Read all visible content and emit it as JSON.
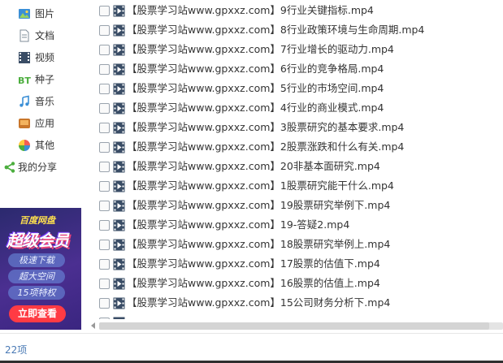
{
  "sidebar": {
    "items": [
      {
        "label": "图片",
        "icon": "picture-icon"
      },
      {
        "label": "文档",
        "icon": "document-icon"
      },
      {
        "label": "视频",
        "icon": "video-icon"
      },
      {
        "label": "种子",
        "icon": "bt-icon"
      },
      {
        "label": "音乐",
        "icon": "music-icon"
      },
      {
        "label": "应用",
        "icon": "app-icon"
      },
      {
        "label": "其他",
        "icon": "other-icon"
      }
    ],
    "share": {
      "label": "我的分享",
      "icon": "share-icon"
    }
  },
  "promo": {
    "brand": "百度网盘",
    "headline": "超级会员",
    "benefits": [
      "极速下载",
      "超大空间",
      "15项特权"
    ],
    "cta": "立即查看"
  },
  "files": [
    "【股票学习站www.gpxxz.com】9行业关键指标.mp4",
    "【股票学习站www.gpxxz.com】8行业政策环境与生命周期.mp4",
    "【股票学习站www.gpxxz.com】7行业增长的驱动力.mp4",
    "【股票学习站www.gpxxz.com】6行业的竞争格局.mp4",
    "【股票学习站www.gpxxz.com】5行业的市场空间.mp4",
    "【股票学习站www.gpxxz.com】4行业的商业模式.mp4",
    "【股票学习站www.gpxxz.com】3股票研究的基本要求.mp4",
    "【股票学习站www.gpxxz.com】2股票涨跌和什么有关.mp4",
    "【股票学习站www.gpxxz.com】20非基本面研究.mp4",
    "【股票学习站www.gpxxz.com】1股票研究能干什么.mp4",
    "【股票学习站www.gpxxz.com】19股票研究举例下.mp4",
    "【股票学习站www.gpxxz.com】19-答疑2.mp4",
    "【股票学习站www.gpxxz.com】18股票研究举例上.mp4",
    "【股票学习站www.gpxxz.com】17股票的估值下.mp4",
    "【股票学习站www.gpxxz.com】16股票的估值上.mp4",
    "【股票学习站www.gpxxz.com】15公司财务分析下.mp4"
  ],
  "status": {
    "count": "22项"
  },
  "colors": {
    "accent": "#4a7ab5",
    "promo_bg": "#3a2580",
    "cta": "#ff3b44"
  }
}
